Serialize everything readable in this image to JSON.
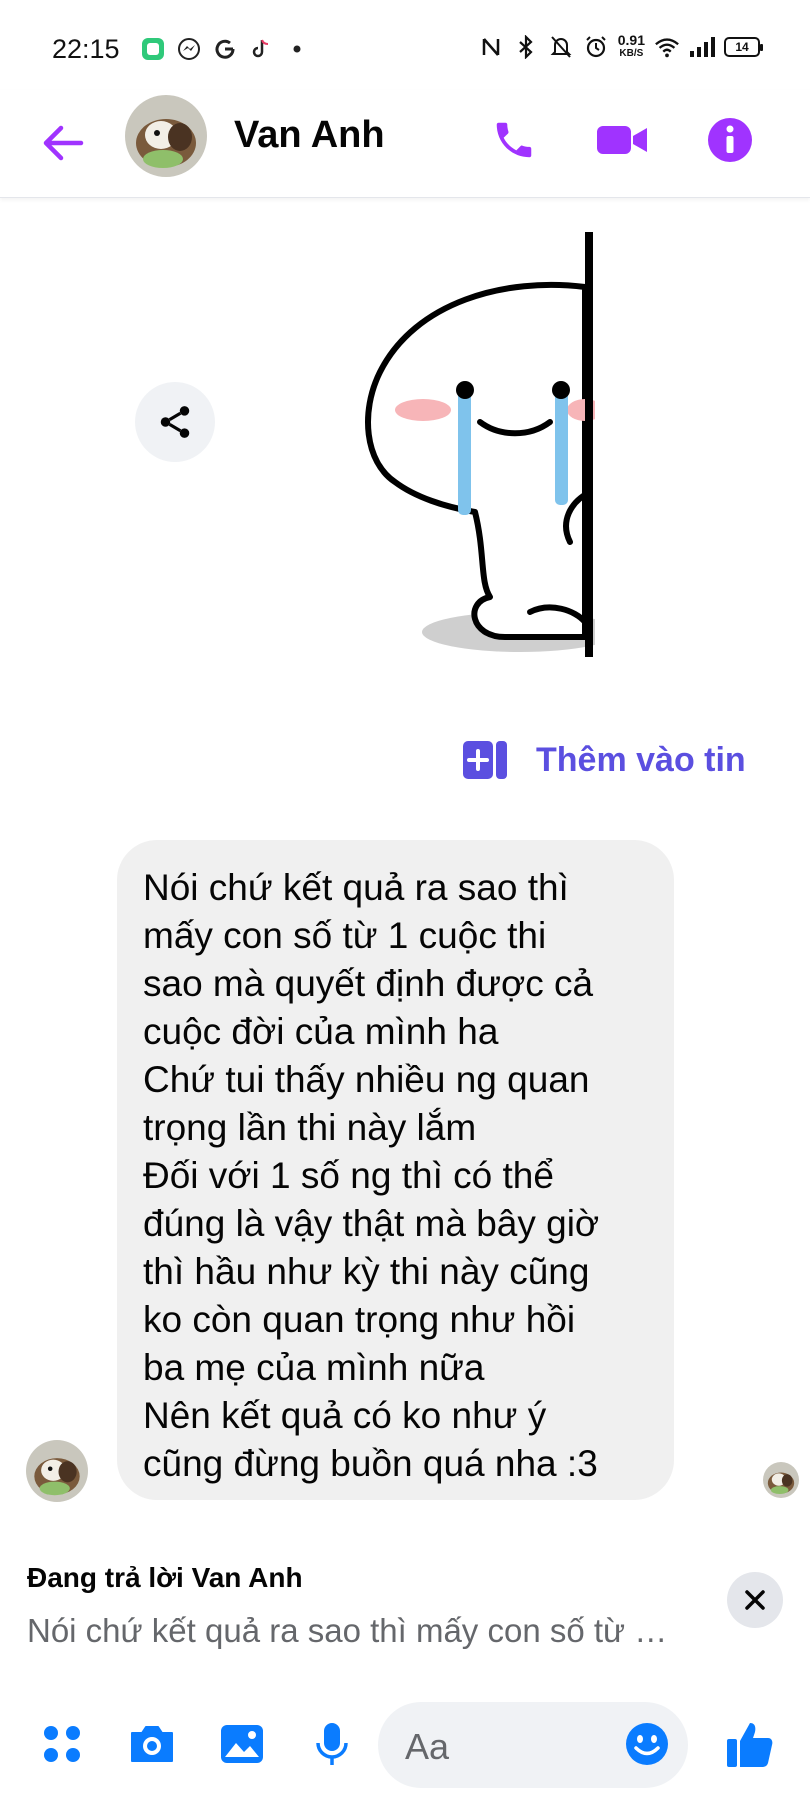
{
  "status_bar": {
    "time": "22:15",
    "netspeed_value": "0.91",
    "netspeed_unit": "KB/S",
    "battery": "14"
  },
  "header": {
    "contact_name": "Van Anh"
  },
  "story": {
    "add_to_story_label": "Thêm vào tin"
  },
  "message": {
    "lines": [
      "Nói chứ kết quả ra sao thì",
      "mấy con số từ 1 cuộc thi",
      "sao mà quyết định được cả",
      "cuộc đời của mình ha",
      "Chứ tui thấy nhiều ng quan",
      "trọng lần thi này lắm",
      "Đối với 1 số ng thì có thể",
      "đúng là vậy thật mà bây giờ",
      "thì hầu như kỳ thi này cũng",
      "ko còn quan trọng như hồi",
      "ba mẹ của mình nữa",
      "Nên kết quả có ko như ý",
      "cũng đừng buồn quá nha :3"
    ]
  },
  "reply": {
    "title": "Đang trả lời Van Anh",
    "snippet": "Nói chứ kết quả ra sao thì mấy con số từ 1 cuộc thi"
  },
  "composer": {
    "placeholder": "Aa"
  },
  "colors": {
    "accent": "#a033ff",
    "composer_blue": "#0a7cff",
    "story_purple": "#5b4fe0",
    "bubble_bg": "#f0f0f0"
  }
}
